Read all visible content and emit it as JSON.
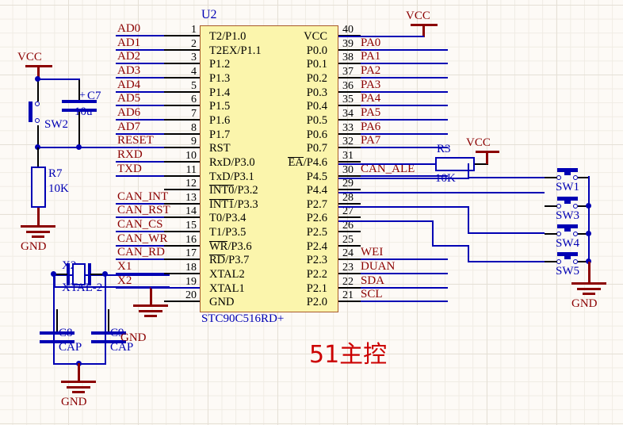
{
  "sheet": {
    "title_annotation": "51主控",
    "background": "#fdfaf6",
    "wire_color": "#0000b4",
    "power_color": "#8b0000",
    "ic_fill": "#fbf5ac",
    "ic_border": "#a85a2a"
  },
  "ic": {
    "ref": "U2",
    "part": "STC90C516RD+",
    "left_pins": [
      {
        "no": "1",
        "name": "T2/P1.0",
        "over": ""
      },
      {
        "no": "2",
        "name": "T2EX/P1.1",
        "over": ""
      },
      {
        "no": "3",
        "name": "P1.2",
        "over": ""
      },
      {
        "no": "4",
        "name": "P1.3",
        "over": ""
      },
      {
        "no": "5",
        "name": "P1.4",
        "over": ""
      },
      {
        "no": "6",
        "name": "P1.5",
        "over": ""
      },
      {
        "no": "7",
        "name": "P1.6",
        "over": ""
      },
      {
        "no": "8",
        "name": "P1.7",
        "over": ""
      },
      {
        "no": "9",
        "name": "RST",
        "over": ""
      },
      {
        "no": "10",
        "name": "RxD/P3.0",
        "over": ""
      },
      {
        "no": "11",
        "name": "TxD/P3.1",
        "over": ""
      },
      {
        "no": "12",
        "name": "INT0/P3.2",
        "over": "INT0"
      },
      {
        "no": "13",
        "name": "INT1/P3.3",
        "over": "INT1"
      },
      {
        "no": "14",
        "name": "T0/P3.4",
        "over": ""
      },
      {
        "no": "15",
        "name": "T1/P3.5",
        "over": ""
      },
      {
        "no": "16",
        "name": "WR/P3.6",
        "over": "WR"
      },
      {
        "no": "17",
        "name": "RD/P3.7",
        "over": "RD"
      },
      {
        "no": "18",
        "name": "XTAL2",
        "over": ""
      },
      {
        "no": "19",
        "name": "XTAL1",
        "over": ""
      },
      {
        "no": "20",
        "name": "GND",
        "over": ""
      }
    ],
    "right_pins": [
      {
        "no": "40",
        "name": "VCC",
        "over": ""
      },
      {
        "no": "39",
        "name": "P0.0",
        "over": ""
      },
      {
        "no": "38",
        "name": "P0.1",
        "over": ""
      },
      {
        "no": "37",
        "name": "P0.2",
        "over": ""
      },
      {
        "no": "36",
        "name": "P0.3",
        "over": ""
      },
      {
        "no": "35",
        "name": "P0.4",
        "over": ""
      },
      {
        "no": "34",
        "name": "P0.5",
        "over": ""
      },
      {
        "no": "33",
        "name": "P0.6",
        "over": ""
      },
      {
        "no": "32",
        "name": "P0.7",
        "over": ""
      },
      {
        "no": "31",
        "name": "EA/P4.6",
        "over": "EA"
      },
      {
        "no": "30",
        "name": "P4.5",
        "over": ""
      },
      {
        "no": "29",
        "name": "P4.4",
        "over": ""
      },
      {
        "no": "28",
        "name": "P2.7",
        "over": ""
      },
      {
        "no": "27",
        "name": "P2.6",
        "over": ""
      },
      {
        "no": "26",
        "name": "P2.5",
        "over": ""
      },
      {
        "no": "25",
        "name": "P2.4",
        "over": ""
      },
      {
        "no": "24",
        "name": "P2.3",
        "over": ""
      },
      {
        "no": "23",
        "name": "P2.2",
        "over": ""
      },
      {
        "no": "22",
        "name": "P2.1",
        "over": ""
      },
      {
        "no": "21",
        "name": "P2.0",
        "over": ""
      }
    ]
  },
  "left_nets": [
    {
      "label": "AD0"
    },
    {
      "label": "AD1"
    },
    {
      "label": "AD2"
    },
    {
      "label": "AD3"
    },
    {
      "label": "AD4"
    },
    {
      "label": "AD5"
    },
    {
      "label": "AD6"
    },
    {
      "label": "AD7"
    },
    {
      "label": "RESET"
    },
    {
      "label": "RXD"
    },
    {
      "label": "TXD"
    },
    {
      "label": "CAN_INT"
    },
    {
      "label": "CAN_RST"
    },
    {
      "label": "CAN_CS"
    },
    {
      "label": "CAN_WR"
    },
    {
      "label": "CAN_RD"
    },
    {
      "label": "X1"
    },
    {
      "label": "X2"
    }
  ],
  "right_nets": [
    {
      "label": "PA0"
    },
    {
      "label": "PA1"
    },
    {
      "label": "PA2"
    },
    {
      "label": "PA3"
    },
    {
      "label": "PA4"
    },
    {
      "label": "PA5"
    },
    {
      "label": "PA6"
    },
    {
      "label": "PA7"
    },
    {
      "label": "CAN_ALE"
    },
    {
      "label": "WEI"
    },
    {
      "label": "DUAN"
    },
    {
      "label": "SDA"
    },
    {
      "label": "SCL"
    }
  ],
  "power": {
    "vcc_reset": "VCC",
    "vcc_ic": "VCC",
    "vcc_r3": "VCC",
    "gnd_r7": "GND",
    "gnd_xtal": "GND",
    "gnd_mid": "GND",
    "gnd_sw": "GND"
  },
  "components": {
    "sw2": {
      "ref": "SW2"
    },
    "c7": {
      "ref": "C7",
      "value": "10u",
      "polarity": "+"
    },
    "r7": {
      "ref": "R7",
      "value": "10K"
    },
    "r3": {
      "ref": "R3",
      "value": "10K"
    },
    "x2": {
      "ref": "X2",
      "value": "XTAL-2"
    },
    "c8": {
      "ref": "C8",
      "value": "CAP"
    },
    "c9": {
      "ref": "C9",
      "value": "CAP"
    },
    "sw1": {
      "ref": "SW1"
    },
    "sw3": {
      "ref": "SW3"
    },
    "sw4": {
      "ref": "SW4"
    },
    "sw5": {
      "ref": "SW5"
    }
  }
}
